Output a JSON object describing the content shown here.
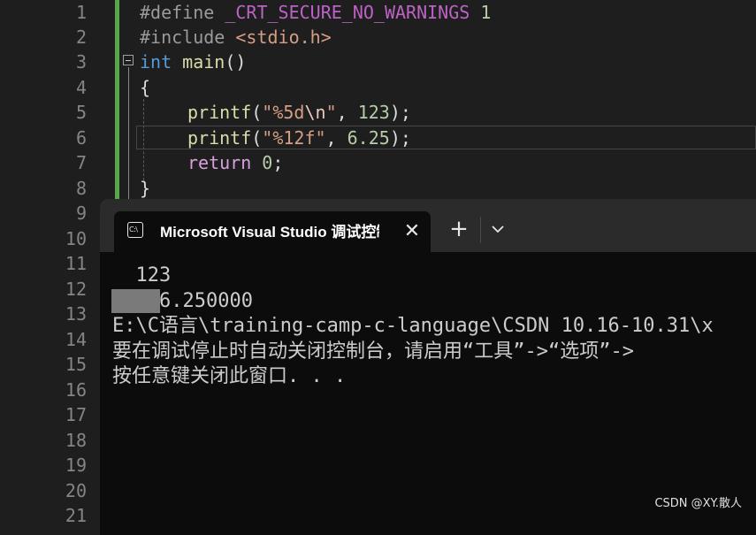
{
  "editor": {
    "line_numbers": [
      "1",
      "2",
      "3",
      "4",
      "5",
      "6",
      "7",
      "8",
      "9",
      "10",
      "11",
      "12",
      "13",
      "14",
      "15",
      "16",
      "17",
      "18",
      "19",
      "20",
      "21"
    ],
    "lines": {
      "l1": {
        "directive": "#define",
        "macro": "_CRT_SECURE_NO_WARNINGS",
        "value": "1"
      },
      "l2": {
        "directive": "#include",
        "header": "<stdio.h>"
      },
      "l3": {
        "type": "int",
        "name": "main",
        "paren": "()"
      },
      "l4": {
        "brace": "{"
      },
      "l5": {
        "fn": "printf",
        "open": "(",
        "str_a": "\"%5d",
        "esc": "\\n",
        "str_b": "\"",
        "sep": ", ",
        "arg": "123",
        "close": ");"
      },
      "l6": {
        "fn": "printf",
        "open": "(",
        "str": "\"%12f\"",
        "sep": ", ",
        "arg": "6.25",
        "close": ");"
      },
      "l7": {
        "kw": "return",
        "arg": "0",
        "close": ";"
      },
      "l8": {
        "brace": "}"
      }
    }
  },
  "console": {
    "tab_title": "Microsoft Visual Studio 调试控制台",
    "tab_icon_text": "C:\\",
    "close_glyph": "✕",
    "new_tab_glyph": "+",
    "output": [
      "  123",
      "    6.250000",
      "E:\\C语言\\training-camp-c-language\\CSDN 10.16-10.31\\x",
      "要在调试停止时自动关闭控制台，请启用“工具”->“选项”->",
      "按任意键关闭此窗口. . ."
    ]
  },
  "watermark": "CSDN @XY.散人",
  "colors": {
    "editor_bg": "#1e1e1e",
    "console_bg": "#0c0c0c",
    "titlebar_bg": "#2b2b2b",
    "change_bar": "#57a64a"
  }
}
